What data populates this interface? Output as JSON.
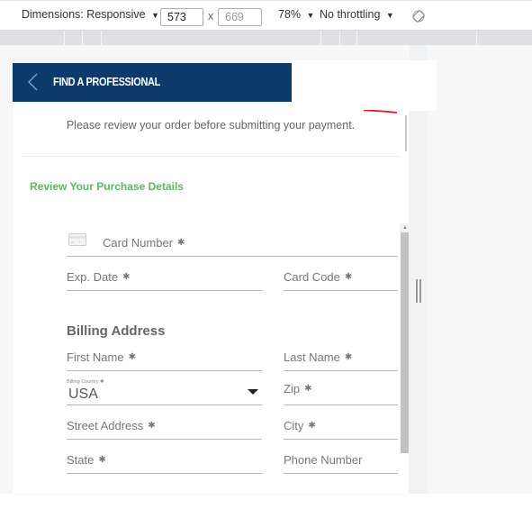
{
  "devtools_toolbar": {
    "dimensions_label": "Dimensions: Responsive",
    "width_value": "573",
    "times_symbol": "x",
    "height_value": "669",
    "zoom_label": "78%",
    "throttling_label": "No throttling",
    "dropdown_arrow": "▼",
    "rotate_icon": "rotate-icon"
  },
  "header": {
    "back_icon": "chevron-left-icon",
    "title": "FIND A PROFESSIONAL",
    "background_color": "#0b3a6b"
  },
  "notice": "Please review your order before submitting your payment.",
  "section_title": "Review Your Purchase Details",
  "section_title_color": "#5cb85c",
  "payment": {
    "card_icon": "credit-card-icon",
    "card_number_label": "Card Number",
    "exp_date_label": "Exp. Date",
    "card_code_label": "Card Code",
    "required_mark": "✱"
  },
  "billing": {
    "title": "Billing Address",
    "first_name_label": "First Name",
    "last_name_label": "Last Name",
    "country_label": "Billing Country",
    "country_value": "USA",
    "zip_label": "Zip",
    "street_label": "Street Address",
    "city_label": "City",
    "state_label": "State",
    "phone_label": "Phone Number"
  },
  "scrollbar": {
    "up_arrow": "▲"
  }
}
